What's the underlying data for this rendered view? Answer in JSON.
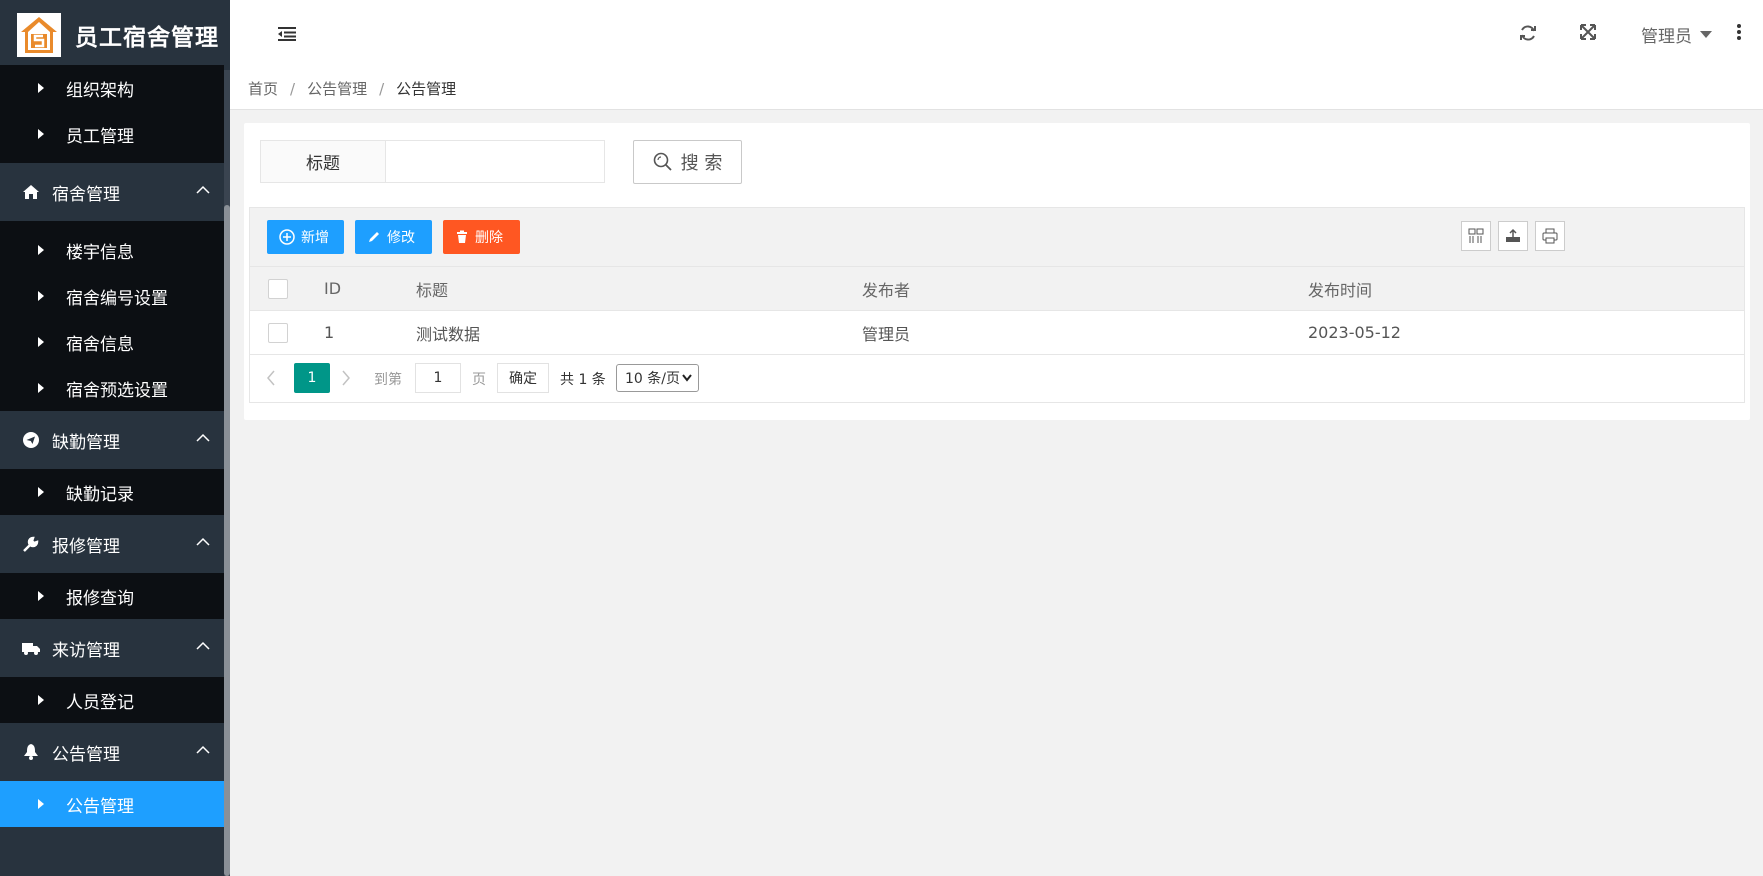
{
  "app": {
    "title": "员工宿舍管理"
  },
  "sidebar": {
    "items": [
      {
        "type": "sub",
        "label": "组织架构"
      },
      {
        "type": "sub",
        "label": "员工管理"
      },
      {
        "type": "group",
        "label": "宿舍管理",
        "icon": "home-icon"
      },
      {
        "type": "sub",
        "label": "楼宇信息"
      },
      {
        "type": "sub",
        "label": "宿舍编号设置"
      },
      {
        "type": "sub",
        "label": "宿舍信息"
      },
      {
        "type": "sub",
        "label": "宿舍预选设置"
      },
      {
        "type": "group",
        "label": "缺勤管理",
        "icon": "send-icon"
      },
      {
        "type": "sub",
        "label": "缺勤记录"
      },
      {
        "type": "group",
        "label": "报修管理",
        "icon": "wrench-icon"
      },
      {
        "type": "sub",
        "label": "报修查询"
      },
      {
        "type": "group",
        "label": "来访管理",
        "icon": "truck-icon"
      },
      {
        "type": "sub",
        "label": "人员登记"
      },
      {
        "type": "group",
        "label": "公告管理",
        "icon": "bell-icon"
      },
      {
        "type": "sub",
        "label": "公告管理",
        "active": true
      }
    ]
  },
  "header": {
    "user": "管理员"
  },
  "breadcrumb": [
    "首页",
    "公告管理",
    "公告管理"
  ],
  "search": {
    "label": "标题",
    "value": "",
    "button": "搜 索"
  },
  "toolbar": {
    "add": "新增",
    "edit": "修改",
    "delete": "删除"
  },
  "table": {
    "columns": [
      "ID",
      "标题",
      "发布者",
      "发布时间"
    ],
    "rows": [
      {
        "id": "1",
        "title": "测试数据",
        "publisher": "管理员",
        "time": "2023-05-12"
      }
    ]
  },
  "pager": {
    "current": "1",
    "goto_label": "到第",
    "goto_value": "1",
    "page_unit": "页",
    "confirm": "确定",
    "total": "共 1 条",
    "page_size": "10 条/页"
  },
  "colors": {
    "sidebar_bg": "#28333e",
    "submenu_bg": "#0c0f13",
    "active": "#1e9fff",
    "danger": "#ff5722",
    "pager_current": "#009688"
  }
}
